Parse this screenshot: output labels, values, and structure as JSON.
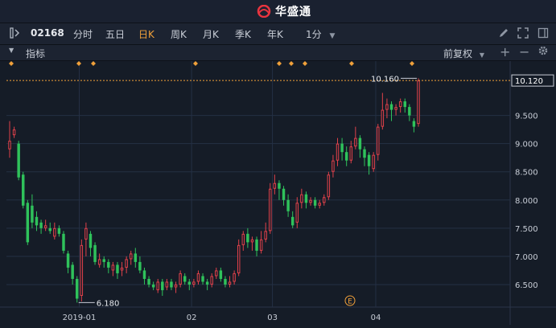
{
  "app": {
    "logo_text": "华盛通"
  },
  "toolbar": {
    "stock_code": "02168",
    "periods": [
      "分时",
      "五日",
      "日K",
      "周K",
      "月K",
      "季K",
      "年K"
    ],
    "active_period": "日K",
    "interval": "1分",
    "icons": [
      "pencil-icon",
      "expand-icon",
      "panel-icon"
    ]
  },
  "indicator_bar": {
    "label": "指标",
    "adjust": "前复权",
    "icons": [
      "plus-icon",
      "minus-icon",
      "settings-icon"
    ]
  },
  "chart_data": {
    "type": "candlestick",
    "colors": {
      "up": "#e0414a",
      "down": "#2fc25b",
      "grid": "#243044",
      "dotted_line": "#f0a03a"
    },
    "ylim": [
      6.1,
      10.35
    ],
    "y_ticks": [
      "10.120",
      "9.500",
      "9.000",
      "8.500",
      "8.000",
      "7.500",
      "7.000",
      "6.500"
    ],
    "current_price_label": "10.120",
    "x_ticks": [
      "2019-01",
      "02",
      "03",
      "04"
    ],
    "annotations": {
      "high_label": "10.160",
      "low_label": "6.180",
      "event_marker": "E"
    },
    "candles": [
      [
        8.9,
        9.05,
        9.4,
        8.75
      ],
      [
        9.15,
        9.25,
        9.3,
        9.1
      ],
      [
        9.0,
        8.4,
        9.05,
        8.35
      ],
      [
        8.45,
        7.9,
        8.5,
        7.85
      ],
      [
        7.95,
        7.25,
        8.0,
        7.2
      ],
      [
        7.9,
        7.6,
        8.1,
        7.5
      ],
      [
        7.7,
        7.55,
        7.8,
        7.45
      ],
      [
        7.6,
        7.5,
        7.65,
        7.4
      ],
      [
        7.5,
        7.55,
        7.65,
        7.45
      ],
      [
        7.5,
        7.45,
        7.6,
        7.4
      ],
      [
        7.35,
        7.5,
        7.6,
        7.3
      ],
      [
        7.5,
        7.4,
        7.55,
        7.35
      ],
      [
        7.4,
        7.1,
        7.45,
        7.05
      ],
      [
        7.05,
        6.8,
        7.1,
        6.7
      ],
      [
        6.85,
        6.6,
        6.9,
        6.5
      ],
      [
        6.6,
        6.25,
        6.65,
        6.18
      ],
      [
        6.3,
        7.2,
        7.3,
        6.2
      ],
      [
        7.3,
        7.5,
        7.6,
        7.0
      ],
      [
        7.4,
        7.15,
        7.45,
        7.0
      ],
      [
        7.2,
        6.9,
        7.25,
        6.85
      ],
      [
        6.85,
        6.95,
        7.05,
        6.8
      ],
      [
        6.95,
        6.9,
        7.0,
        6.8
      ],
      [
        6.9,
        6.8,
        6.95,
        6.7
      ],
      [
        6.75,
        6.85,
        6.9,
        6.65
      ],
      [
        6.85,
        6.7,
        6.9,
        6.6
      ],
      [
        6.75,
        6.8,
        6.9,
        6.65
      ],
      [
        6.8,
        6.95,
        7.0,
        6.7
      ],
      [
        6.95,
        7.05,
        7.1,
        6.85
      ],
      [
        7.05,
        6.9,
        7.15,
        6.8
      ],
      [
        6.9,
        6.75,
        7.0,
        6.7
      ],
      [
        6.75,
        6.6,
        6.8,
        6.5
      ],
      [
        6.6,
        6.5,
        6.65,
        6.45
      ],
      [
        6.5,
        6.45,
        6.55,
        6.4
      ],
      [
        6.4,
        6.55,
        6.6,
        6.35
      ],
      [
        6.55,
        6.4,
        6.6,
        6.3
      ],
      [
        6.45,
        6.55,
        6.6,
        6.4
      ],
      [
        6.55,
        6.45,
        6.6,
        6.4
      ],
      [
        6.45,
        6.5,
        6.55,
        6.35
      ],
      [
        6.5,
        6.7,
        6.75,
        6.45
      ],
      [
        6.65,
        6.55,
        6.7,
        6.5
      ],
      [
        6.55,
        6.5,
        6.6,
        6.4
      ],
      [
        6.5,
        6.55,
        6.6,
        6.45
      ],
      [
        6.55,
        6.7,
        6.75,
        6.5
      ],
      [
        6.65,
        6.55,
        6.7,
        6.5
      ],
      [
        6.55,
        6.5,
        6.6,
        6.4
      ],
      [
        6.5,
        6.65,
        6.7,
        6.45
      ],
      [
        6.65,
        6.75,
        6.8,
        6.6
      ],
      [
        6.75,
        6.6,
        6.8,
        6.55
      ],
      [
        6.6,
        6.5,
        6.65,
        6.45
      ],
      [
        6.5,
        6.55,
        6.65,
        6.45
      ],
      [
        6.55,
        6.7,
        6.75,
        6.5
      ],
      [
        6.7,
        7.2,
        7.3,
        6.65
      ],
      [
        7.2,
        7.4,
        7.45,
        7.1
      ],
      [
        7.4,
        7.25,
        7.5,
        7.15
      ],
      [
        7.25,
        7.3,
        7.35,
        7.1
      ],
      [
        7.3,
        7.1,
        7.35,
        7.0
      ],
      [
        7.1,
        7.3,
        7.45,
        7.05
      ],
      [
        7.3,
        7.45,
        7.6,
        7.25
      ],
      [
        7.45,
        8.2,
        8.3,
        7.4
      ],
      [
        8.2,
        8.3,
        8.45,
        8.1
      ],
      [
        8.3,
        8.2,
        8.35,
        8.0
      ],
      [
        8.2,
        8.0,
        8.25,
        7.9
      ],
      [
        8.0,
        7.8,
        8.1,
        7.7
      ],
      [
        7.7,
        7.55,
        7.8,
        7.5
      ],
      [
        7.6,
        7.95,
        8.05,
        7.5
      ],
      [
        7.95,
        8.1,
        8.2,
        7.85
      ],
      [
        8.1,
        7.95,
        8.15,
        7.85
      ],
      [
        7.95,
        8.0,
        8.05,
        7.9
      ],
      [
        8.0,
        7.9,
        8.05,
        7.85
      ],
      [
        7.9,
        7.95,
        8.0,
        7.85
      ],
      [
        7.95,
        8.05,
        8.1,
        7.9
      ],
      [
        8.05,
        8.45,
        8.5,
        8.0
      ],
      [
        8.5,
        8.7,
        8.8,
        8.4
      ],
      [
        8.7,
        9.0,
        9.1,
        8.6
      ],
      [
        9.0,
        8.85,
        9.1,
        8.7
      ],
      [
        8.85,
        8.7,
        8.95,
        8.6
      ],
      [
        8.7,
        8.95,
        9.05,
        8.65
      ],
      [
        8.95,
        9.1,
        9.3,
        8.9
      ],
      [
        9.1,
        8.9,
        9.15,
        8.75
      ],
      [
        8.9,
        8.75,
        8.95,
        8.6
      ],
      [
        8.8,
        8.6,
        8.85,
        8.45
      ],
      [
        8.55,
        8.8,
        8.85,
        8.5
      ],
      [
        8.8,
        9.3,
        9.35,
        8.7
      ],
      [
        9.3,
        9.6,
        9.9,
        9.25
      ],
      [
        9.6,
        9.7,
        9.8,
        9.45
      ],
      [
        9.7,
        9.6,
        9.75,
        9.4
      ],
      [
        9.6,
        9.65,
        9.7,
        9.5
      ],
      [
        9.65,
        9.75,
        9.8,
        9.55
      ],
      [
        9.75,
        9.65,
        9.8,
        9.55
      ],
      [
        9.65,
        9.5,
        9.7,
        9.4
      ],
      [
        9.4,
        9.3,
        9.45,
        9.2
      ],
      [
        9.35,
        10.12,
        10.16,
        9.3
      ]
    ]
  }
}
